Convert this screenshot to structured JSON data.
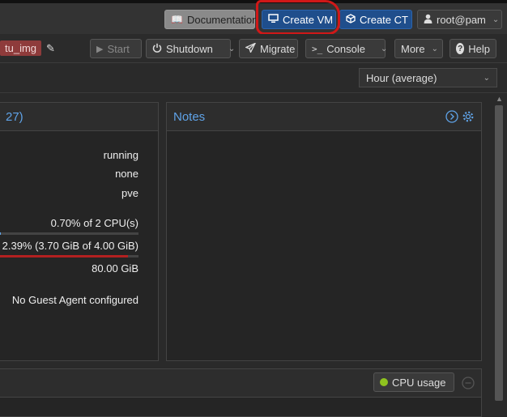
{
  "header": {
    "documentation_label": "Documentation",
    "create_vm_label": "Create VM",
    "create_ct_label": "Create CT",
    "user_label": "root@pam"
  },
  "toolbar": {
    "vm_tag": "tu_img",
    "start_label": "Start",
    "shutdown_label": "Shutdown",
    "migrate_label": "Migrate",
    "console_label": "Console",
    "more_label": "More",
    "help_label": "Help"
  },
  "timeframe": {
    "selected": "Hour (average)"
  },
  "summary": {
    "title_fragment": "27)",
    "status": "running",
    "ha_state": "none",
    "node": "pve",
    "cpu_usage": "0.70% of 2 CPU(s)",
    "cpu_fraction": 0.007,
    "memory_usage": "2.39% (3.70 GiB of 4.00 GiB)",
    "memory_fraction": 0.925,
    "bootdisk_size": "80.00 GiB",
    "ips": "No Guest Agent configured"
  },
  "notes": {
    "title": "Notes"
  },
  "graph": {
    "legend_label": "CPU usage"
  },
  "colors": {
    "accent_blue": "#1f4e8c",
    "link_blue": "#5fa3e8",
    "memory_bar": "#b32020",
    "legend_dot": "#8fc31f",
    "annotation_red": "#d01818"
  }
}
